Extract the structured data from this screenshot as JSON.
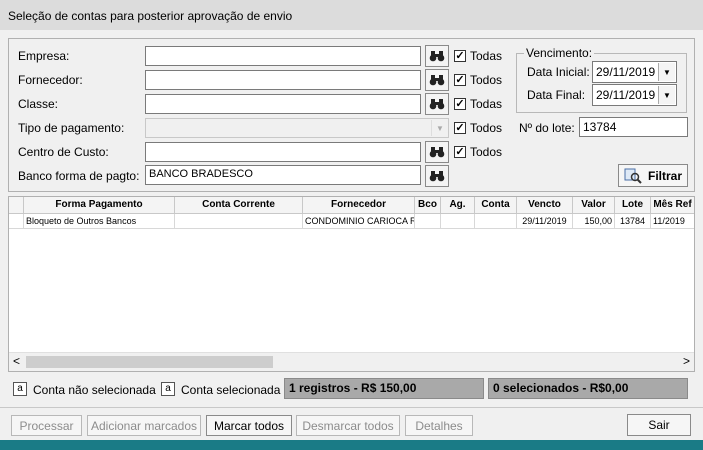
{
  "window": {
    "title": "Seleção de contas para posterior aprovação de envio"
  },
  "filters": {
    "empresa_label": "Empresa:",
    "empresa_value": "",
    "empresa_todas": "Todas",
    "fornecedor_label": "Fornecedor:",
    "fornecedor_value": "",
    "fornecedor_todos": "Todos",
    "classe_label": "Classe:",
    "classe_value": "",
    "classe_todas": "Todas",
    "tipo_label": "Tipo de pagamento:",
    "tipo_value": "",
    "tipo_todos": "Todos",
    "centro_label": "Centro de Custo:",
    "centro_value": "",
    "centro_todos": "Todos",
    "banco_label": "Banco forma de pagto:",
    "banco_value": "BANCO BRADESCO"
  },
  "vencimento": {
    "legend": "Vencimento:",
    "inicial_label": "Data Inicial:",
    "inicial_value": "29/11/2019",
    "final_label": "Data Final:",
    "final_value": "29/11/2019"
  },
  "lote": {
    "label": "Nº do lote:",
    "value": "13784"
  },
  "filtrar_button": "Filtrar",
  "grid": {
    "columns": [
      "Forma Pagamento",
      "Conta Corrente",
      "Fornecedor",
      "Bco",
      "Ag.",
      "Conta",
      "Vencto",
      "Valor",
      "Lote",
      "Mês Ref"
    ],
    "rows": [
      [
        "Bloqueto de Outros Bancos",
        "",
        "CONDOMINIO CARIOCA RES",
        "",
        "",
        "",
        "29/11/2019",
        "150,00",
        "13784",
        "11/2019"
      ]
    ]
  },
  "legend_status": {
    "nao_sel_letter": "a",
    "nao_sel_label": "Conta não selecionada",
    "sel_letter": "a",
    "sel_label": "Conta selecionada",
    "registros": "1 registros - R$ 150,00",
    "selecionados": "0 selecionados - R$0,00"
  },
  "buttons": {
    "processar": "Processar",
    "adicionar": "Adicionar marcados",
    "marcar": "Marcar todos",
    "desmarcar": "Desmarcar todos",
    "detalhes": "Detalhes",
    "sair": "Sair"
  },
  "scroll": {
    "left_arrow": "<",
    "right_arrow": ">"
  }
}
